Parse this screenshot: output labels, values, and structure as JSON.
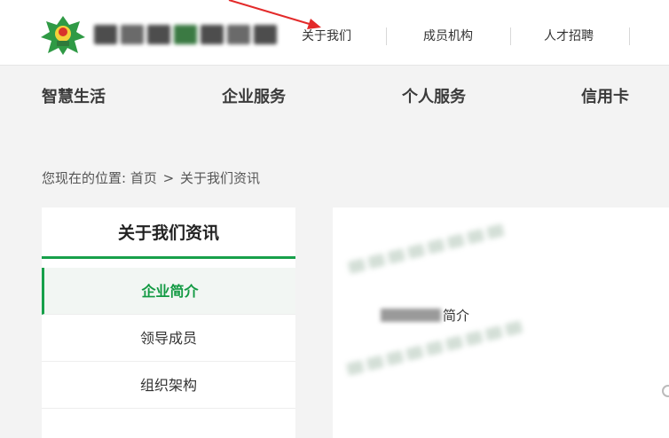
{
  "header": {
    "logo_name": "company-logo",
    "top_nav": [
      {
        "label": "关于我们"
      },
      {
        "label": "成员机构"
      },
      {
        "label": "人才招聘"
      }
    ]
  },
  "main_nav": [
    {
      "label": "智慧生活"
    },
    {
      "label": "企业服务"
    },
    {
      "label": "个人服务"
    },
    {
      "label": "信用卡"
    }
  ],
  "breadcrumb": {
    "prefix": "您现在的位置:",
    "home": "首页",
    "separator": ">",
    "current": "关于我们资讯"
  },
  "sidebar": {
    "title": "关于我们资讯",
    "items": [
      {
        "label": "企业简介",
        "active": true
      },
      {
        "label": "领导成员",
        "active": false
      },
      {
        "label": "组织架构",
        "active": false
      }
    ]
  },
  "content": {
    "intro_suffix": "简介"
  },
  "colors": {
    "accent": "#17a04a",
    "annotation_arrow": "#e32a2a"
  }
}
